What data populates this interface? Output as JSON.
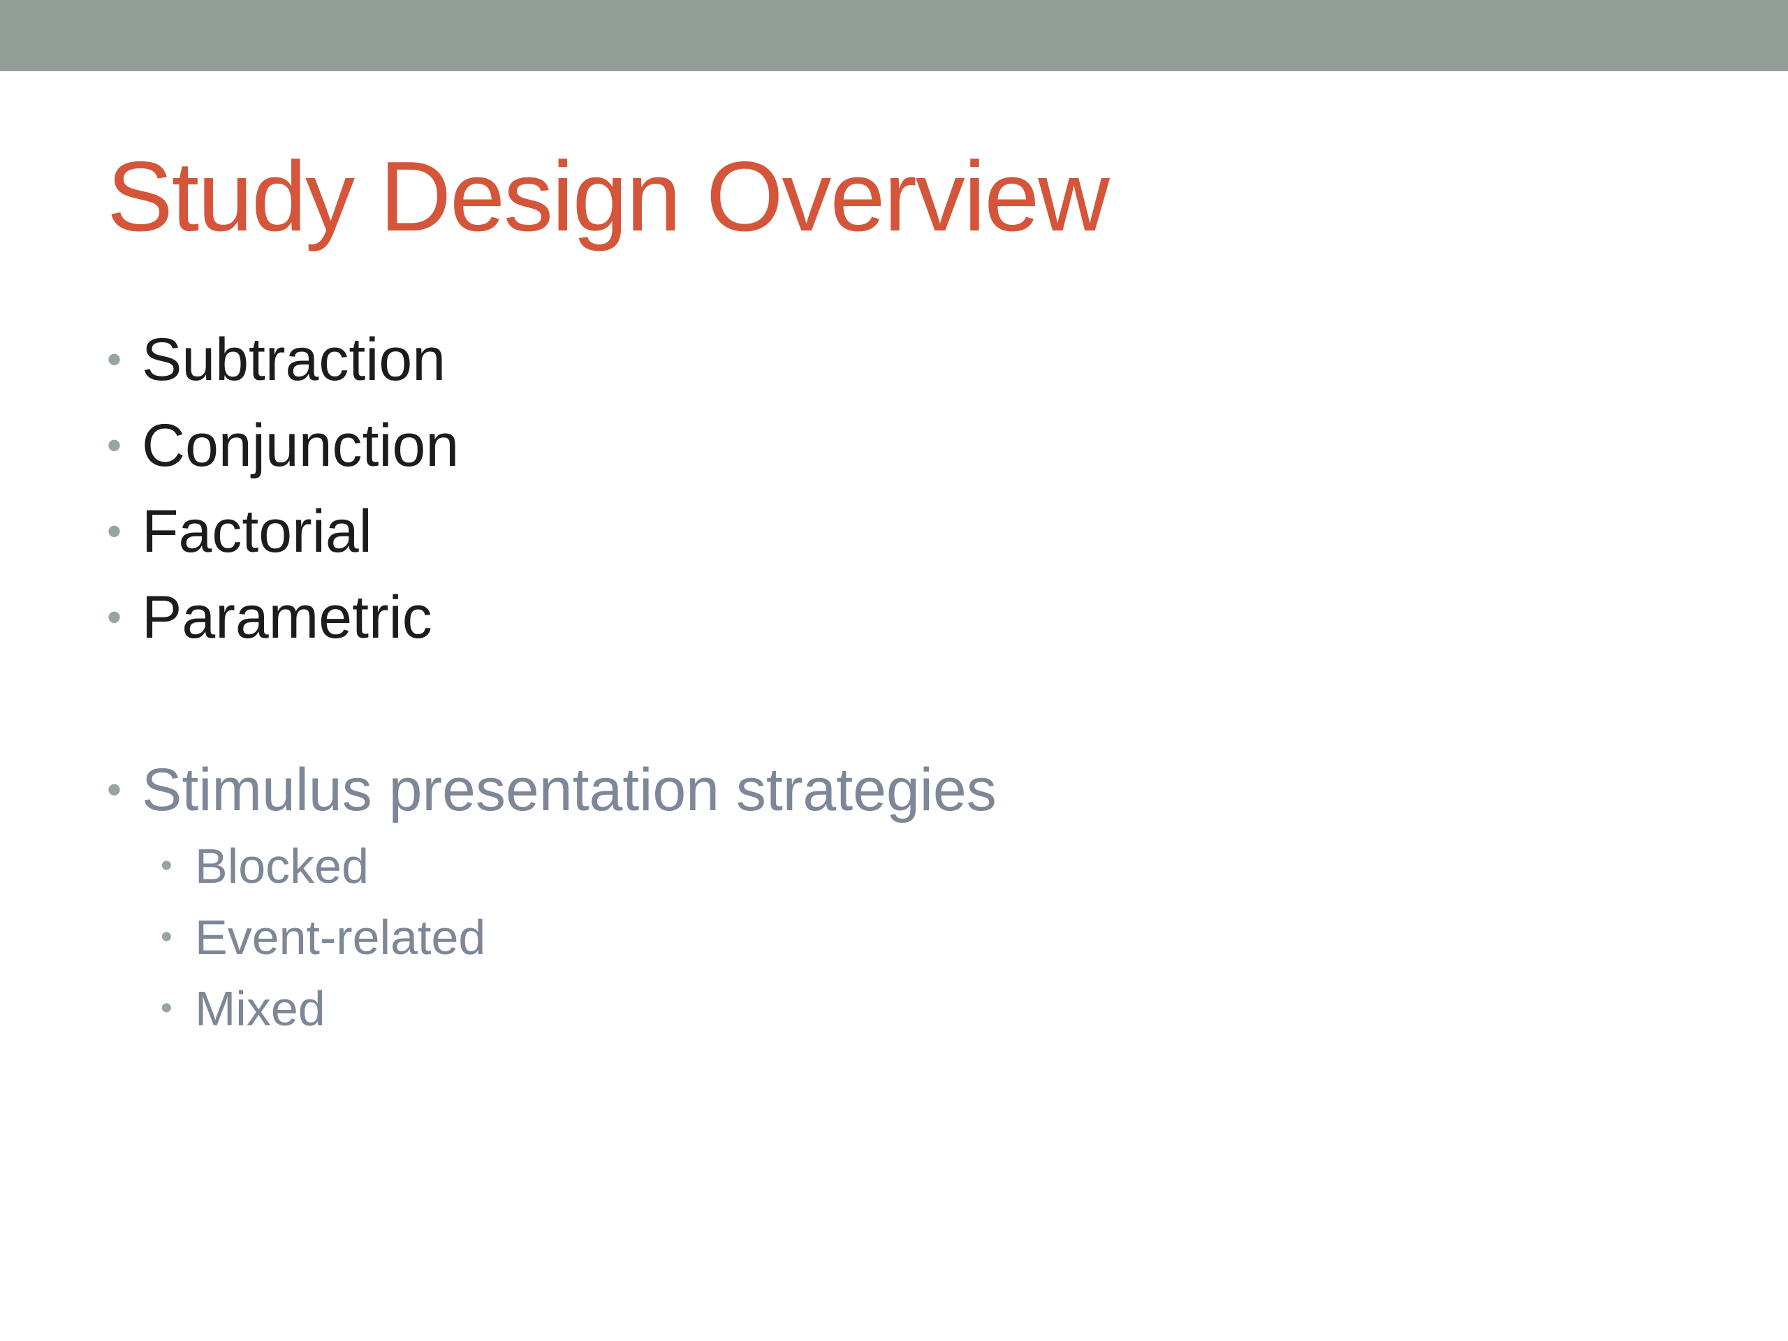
{
  "colors": {
    "top_band": "#929f98",
    "title": "#d4553a",
    "primary_text": "#1c1c1c",
    "secondary_text": "#7d8797",
    "bullet": "#97a69c"
  },
  "slide": {
    "title": "Study Design Overview",
    "design_items": [
      "Subtraction",
      "Conjunction",
      "Factorial",
      "Parametric"
    ],
    "strategies": {
      "label": "Stimulus presentation strategies",
      "items": [
        "Blocked",
        "Event-related",
        "Mixed"
      ]
    }
  }
}
